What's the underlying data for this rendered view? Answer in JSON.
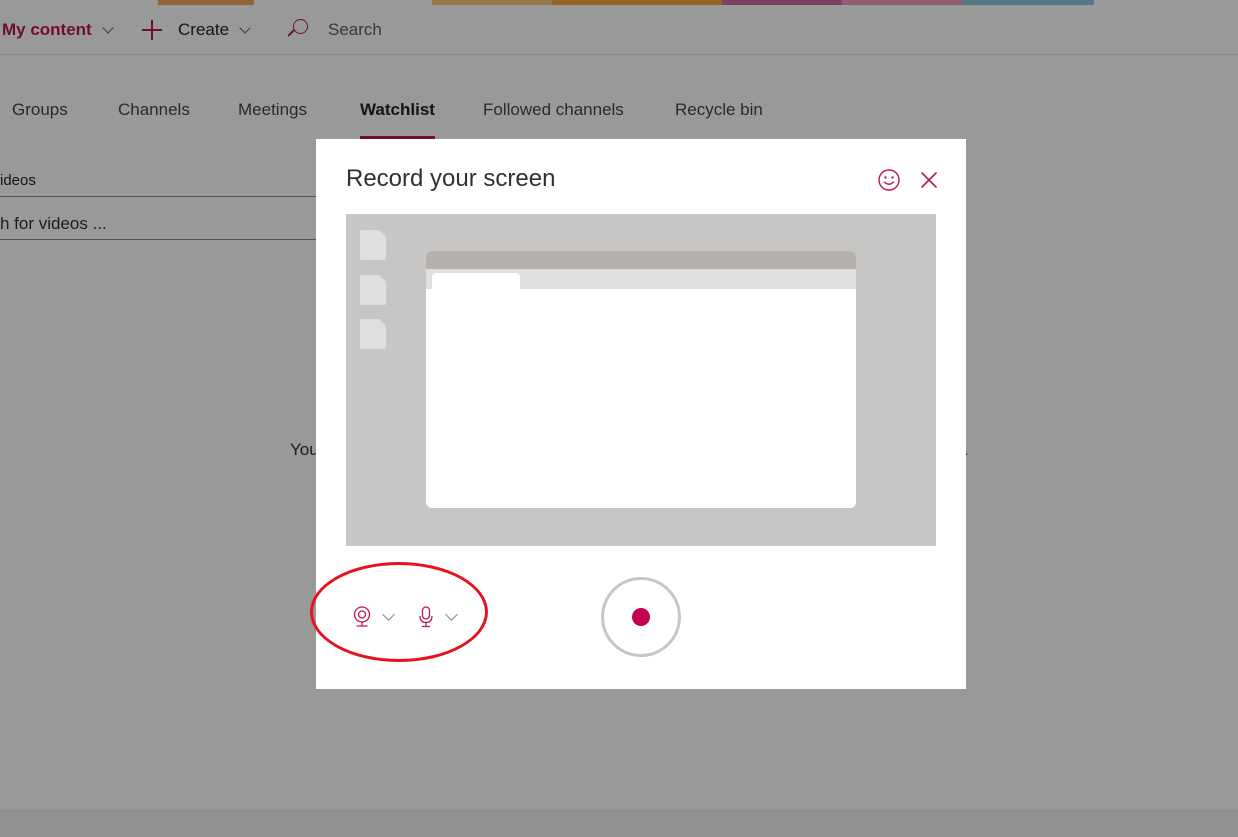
{
  "header": {
    "my_content": "My content",
    "create": "Create",
    "search": "Search"
  },
  "tabs": [
    {
      "label": "Groups"
    },
    {
      "label": "Channels"
    },
    {
      "label": "Meetings"
    },
    {
      "label": "Watchlist",
      "active": true
    },
    {
      "label": "Followed channels"
    },
    {
      "label": "Recycle bin"
    }
  ],
  "content": {
    "filter_label": "ideos",
    "search_placeholder": "h for videos ...",
    "empty_left": "You",
    "empty_right": "."
  },
  "dialog": {
    "title": "Record your screen",
    "feedback_icon": "smiley-icon",
    "close_icon": "close-icon",
    "camera_icon": "webcam-icon",
    "mic_icon": "microphone-icon",
    "record_icon": "record-icon"
  },
  "colors": {
    "accent": "#bc1948",
    "record": "#c30052",
    "annotation": "#e8121e"
  }
}
